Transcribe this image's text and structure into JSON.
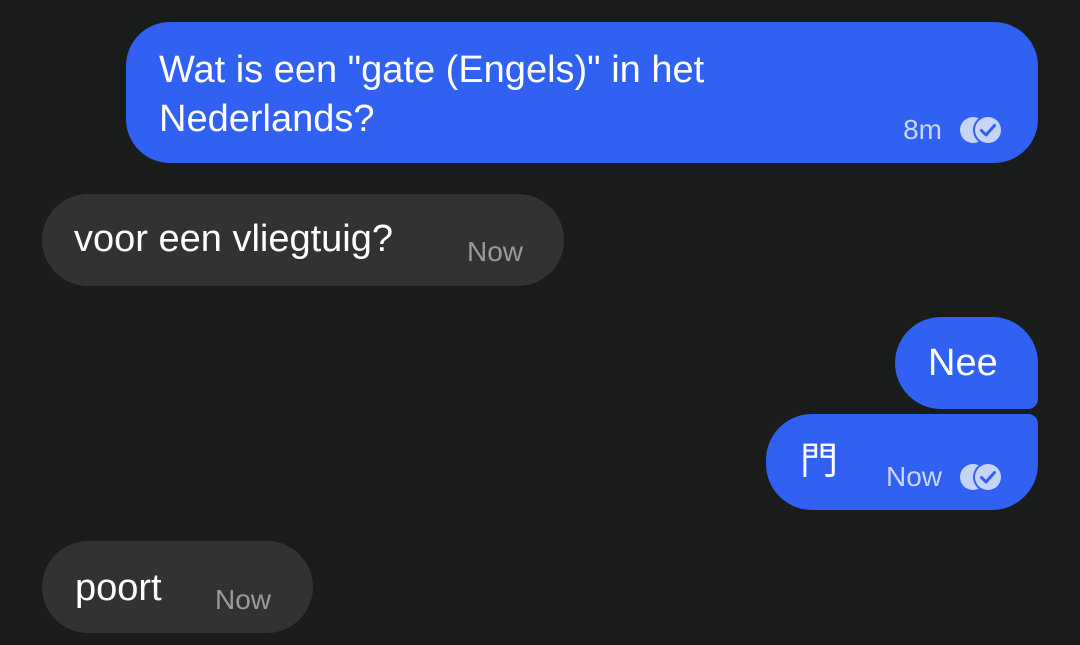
{
  "messages": [
    {
      "direction": "outgoing",
      "text": "Wat is een \"gate (Engels)\" in het Nederlands?",
      "time": "8m",
      "receipt_icon": "read-receipt-icon"
    },
    {
      "direction": "incoming",
      "text": "voor een vliegtuig?",
      "time": "Now"
    },
    {
      "direction": "outgoing",
      "text": "Nee"
    },
    {
      "direction": "outgoing",
      "text": "門",
      "time": "Now",
      "receipt_icon": "read-receipt-icon"
    },
    {
      "direction": "incoming",
      "text": "poort",
      "time": "Now"
    }
  ],
  "colors": {
    "background": "#1a1c1b",
    "outgoing_bubble": "#3061f2",
    "incoming_bubble": "#323232"
  }
}
